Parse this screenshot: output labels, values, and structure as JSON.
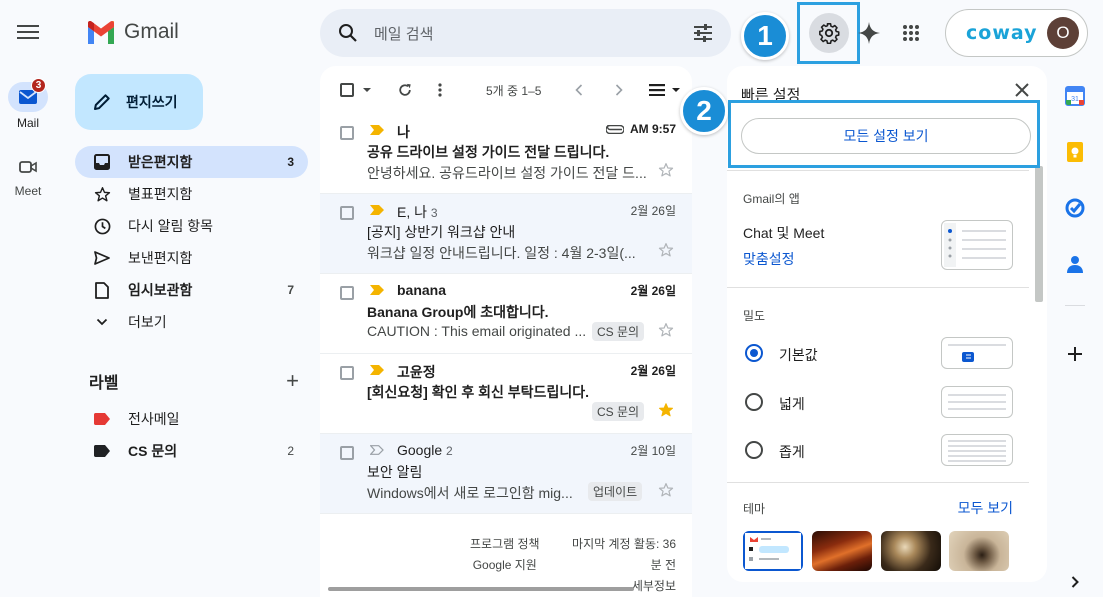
{
  "app": {
    "name": "Gmail"
  },
  "rail": {
    "mail": {
      "label": "Mail",
      "badge": "3"
    },
    "meet": {
      "label": "Meet"
    }
  },
  "header": {
    "search_placeholder": "메일 검색",
    "account_brand": "coway",
    "avatar_initial": "O"
  },
  "steps": {
    "one": "1",
    "two": "2"
  },
  "sidebar": {
    "compose": "편지쓰기",
    "items": [
      {
        "label": "받은편지함",
        "count": "3",
        "icon": "inbox-icon"
      },
      {
        "label": "별표편지함",
        "count": "",
        "icon": "star-outline-icon"
      },
      {
        "label": "다시 알림 항목",
        "count": "",
        "icon": "clock-icon"
      },
      {
        "label": "보낸편지함",
        "count": "",
        "icon": "send-icon"
      },
      {
        "label": "임시보관함",
        "count": "7",
        "icon": "draft-icon"
      },
      {
        "label": "더보기",
        "count": "",
        "icon": "chevron-down-icon"
      }
    ],
    "labels_title": "라벨",
    "labels": [
      {
        "label": "전사메일",
        "count": "",
        "color": "#e53935"
      },
      {
        "label": "CS 문의",
        "count": "2",
        "color": "#202124"
      }
    ]
  },
  "list": {
    "pagination": "5개 중 1–5",
    "emails": [
      {
        "sender": "나",
        "count": "",
        "date": "AM 9:57",
        "subject": "공유 드라이브 설정 가이드 전달 드립니다.",
        "snippet": "안녕하세요. 공유드라이브 설정 가이드 전달 드...",
        "chip": "",
        "attachment": true,
        "starred": false,
        "unread": true,
        "important": true
      },
      {
        "sender": "E, 나",
        "count": "3",
        "date": "2월 26일",
        "subject": "[공지] 상반기 워크샵 안내",
        "snippet": "워크샵 일정 안내드립니다. 일정 : 4월 2-3일(...",
        "chip": "",
        "attachment": false,
        "starred": false,
        "unread": false,
        "important": true
      },
      {
        "sender": "banana",
        "count": "",
        "date": "2월 26일",
        "subject": "Banana Group에 초대합니다.",
        "snippet": "CAUTION : This email originated ...",
        "chip": "CS 문의",
        "attachment": false,
        "starred": false,
        "unread": true,
        "important": true
      },
      {
        "sender": "고윤정",
        "count": "",
        "date": "2월 26일",
        "subject": "[회신요청] 확인 후 회신 부탁드립니다.",
        "snippet": "",
        "chip": "CS 문의",
        "attachment": false,
        "starred": true,
        "unread": true,
        "important": true
      },
      {
        "sender": "Google",
        "count": "2",
        "date": "2월 10일",
        "subject": "보안 알림",
        "snippet": "Windows에서 새로 로그인함 mig...",
        "chip": "업데이트",
        "attachment": false,
        "starred": false,
        "unread": false,
        "important": false
      }
    ],
    "footer": {
      "policy": "프로그램 정책",
      "support": "Google 지원",
      "activity_1": "마지막 계정 활동: 36",
      "activity_2": "분 전",
      "activity_3": "세부정보"
    }
  },
  "quick_settings": {
    "title": "빠른 설정",
    "see_all": "모든 설정 보기",
    "apps_section": "Gmail의 앱",
    "apps_label": "Chat 및 Meet",
    "customize": "맞춤설정",
    "density_section": "밀도",
    "density_options": [
      {
        "label": "기본값",
        "selected": true
      },
      {
        "label": "넓게",
        "selected": false
      },
      {
        "label": "좁게",
        "selected": false
      }
    ],
    "theme_section": "테마",
    "theme_see_all": "모두 보기"
  },
  "colors": {
    "accent": "#0b57d0",
    "highlight": "#2ca0e0",
    "step_badge": "#1a8dd6",
    "brand": "#1aa3d8",
    "important": "#f4b400"
  }
}
